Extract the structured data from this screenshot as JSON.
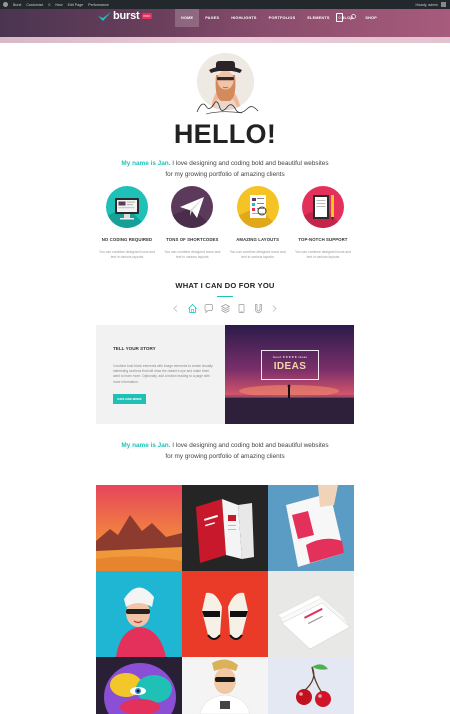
{
  "admin_bar": {
    "items": [
      "Burst",
      "Customize",
      "0",
      "New",
      "Edit Page",
      "Performance"
    ],
    "user": "Howdy, admin"
  },
  "header": {
    "logo_text": "burst",
    "logo_badge": "PRO",
    "nav": [
      "HOME",
      "PAGES",
      "HIGHLIGHTS",
      "PORTFOLIOS",
      "ELEMENTS",
      "BLOG",
      "SHOP"
    ],
    "active_nav": "HOME",
    "cart_count": "0"
  },
  "hello": {
    "title": "HELLO!",
    "intro_accent": "My name is Jan.",
    "intro_rest": " I love designing and coding bold and beautiful websites",
    "intro_line2": "for my growing portfolio of amazing clients"
  },
  "features": [
    {
      "title": "NO CODING REQUIRED",
      "text": "You can combine designed icons and text in various layouts",
      "icon": "monitor-icon",
      "color": "#1fc1b7"
    },
    {
      "title": "TONS OF SHORTCODES",
      "text": "You can combine designed icons and text in various layouts",
      "icon": "paper-plane-icon",
      "color": "#5c3a5c"
    },
    {
      "title": "AMAZING LAYOUTS",
      "text": "You can combine designed icons and text in various layouts",
      "icon": "layout-sheet-icon",
      "color": "#f5c324"
    },
    {
      "title": "TOP-NOTCH SUPPORT",
      "text": "You can combine designed icons and text in various layouts",
      "icon": "notebook-icon",
      "color": "#e4315b"
    }
  ],
  "what_i_can_do": {
    "title": "WHAT I CAN DO FOR YOU",
    "tabs": [
      "home-icon",
      "chat-icon",
      "layers-icon",
      "mobile-icon",
      "magnet-icon"
    ]
  },
  "story": {
    "title": "TELL YOUR STORY",
    "text": "Combine bold block elements with image elements to create visually interesting sections that will draw the reader's eye and make them want to learn more. Optionally, add a button leading to a page with more information.",
    "button": "EXPLORE MORE",
    "ideas_small": "Good ★★★★★ ideas",
    "ideas_big": "IDEAS"
  },
  "intro2": {
    "accent": "My name is Jan.",
    "rest": " I love designing and coding bold and beautiful websites",
    "line2": "for my growing portfolio of amazing clients"
  }
}
